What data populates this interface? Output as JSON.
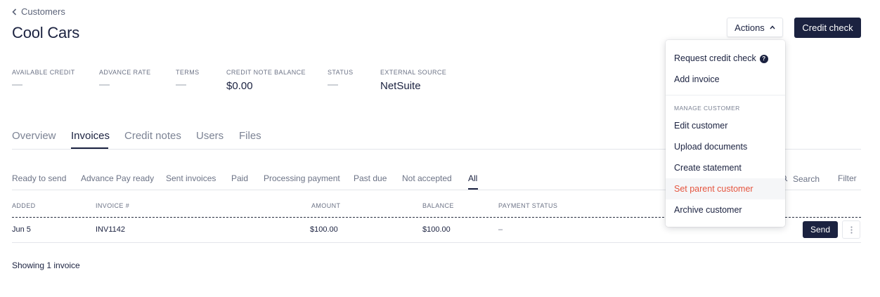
{
  "breadcrumb": {
    "back_label": "Customers"
  },
  "page": {
    "title": "Cool Cars"
  },
  "header": {
    "actions_label": "Actions",
    "credit_check_label": "Credit check"
  },
  "stats": [
    {
      "label": "AVAILABLE CREDIT",
      "value": "—"
    },
    {
      "label": "ADVANCE RATE",
      "value": "—"
    },
    {
      "label": "TERMS",
      "value": "—"
    },
    {
      "label": "CREDIT NOTE BALANCE",
      "value": "$0.00"
    },
    {
      "label": "STATUS",
      "value": "—"
    },
    {
      "label": "EXTERNAL SOURCE",
      "value": "NetSuite"
    }
  ],
  "tabs": [
    {
      "label": "Overview"
    },
    {
      "label": "Invoices",
      "active": true
    },
    {
      "label": "Credit notes"
    },
    {
      "label": "Users"
    },
    {
      "label": "Files"
    }
  ],
  "filters": [
    {
      "label": "Ready to send"
    },
    {
      "label": "Advance Pay ready"
    },
    {
      "label": "Sent invoices"
    },
    {
      "label": "Paid"
    },
    {
      "label": "Processing payment"
    },
    {
      "label": "Past due"
    },
    {
      "label": "Not accepted"
    },
    {
      "label": "All",
      "active": true
    }
  ],
  "toolbar": {
    "search_label": "Search",
    "filter_label": "Filter"
  },
  "table": {
    "columns": [
      "ADDED",
      "INVOICE #",
      "AMOUNT",
      "BALANCE",
      "PAYMENT STATUS"
    ],
    "rows": [
      {
        "added": "Jun 5",
        "invoice": "INV1142",
        "amount": "$100.00",
        "balance": "$100.00",
        "payment_status": "–",
        "action": "Send"
      }
    ]
  },
  "footer": {
    "showing": "Showing 1 invoice"
  },
  "actions_menu": {
    "items_top": [
      "Request credit check",
      "Add invoice"
    ],
    "section_label": "MANAGE CUSTOMER",
    "items_manage": [
      "Edit customer",
      "Upload documents",
      "Create statement",
      "Set parent customer",
      "Archive customer"
    ],
    "highlighted_item": "Set parent customer"
  },
  "colors": {
    "primary": "#1b2240",
    "danger": "#e5553f",
    "muted": "#6c7386"
  }
}
